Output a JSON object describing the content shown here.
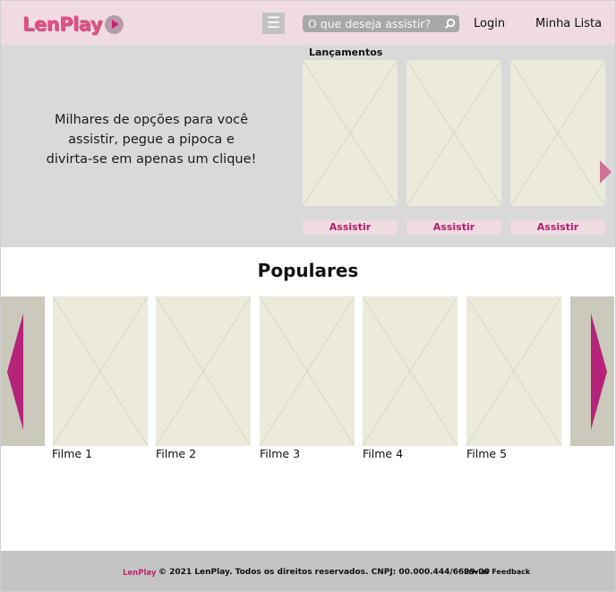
{
  "brand": {
    "name": "LenPlay",
    "accent": "#e04f85",
    "accent_dark": "#b5247a"
  },
  "header": {
    "menu_icon": "hamburger-icon",
    "search_placeholder": "O que deseja assistir?",
    "search_icon": "search-icon",
    "login_label": "Login",
    "mylist_label": "Minha Lista"
  },
  "hero": {
    "tagline": "Milhares de opções para você assistir, pegue a pipoca e divirta-se em apenas um clique!",
    "launches_title": "Lançamentos",
    "watch_labels": [
      "Assistir",
      "Assistir",
      "Assistir"
    ],
    "next_icon": "chevron-right-icon"
  },
  "popular": {
    "title": "Populares",
    "movies": [
      "Filme 1",
      "Filme 2",
      "Filme 3",
      "Filme 4",
      "Filme 5"
    ],
    "prev_icon": "arrow-left-icon",
    "next_icon": "arrow-right-icon"
  },
  "footer": {
    "logo": "LenPlay",
    "copyright": "© 2021 LenPlay. Todos os direitos reservados. CNPJ: 00.000.444/6699-00",
    "feedback_label": "Enviar Feedback"
  }
}
